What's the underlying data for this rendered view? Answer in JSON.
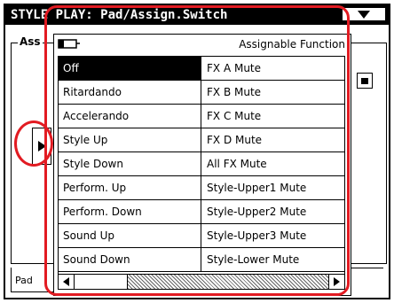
{
  "window": {
    "title": "STYLE PLAY: Pad/Assign.Switch"
  },
  "background": {
    "frame_label": "Ass",
    "tab_label": "Pad"
  },
  "popup": {
    "header_label": "Assignable Function",
    "rows": [
      {
        "left": "Off",
        "right": "FX A Mute",
        "selected": true
      },
      {
        "left": "Ritardando",
        "right": "FX B Mute"
      },
      {
        "left": "Accelerando",
        "right": "FX C Mute"
      },
      {
        "left": "Style Up",
        "right": "FX D Mute"
      },
      {
        "left": "Style Down",
        "right": "All FX Mute"
      },
      {
        "left": "Perform. Up",
        "right": "Style-Upper1 Mute"
      },
      {
        "left": "Perform. Down",
        "right": "Style-Upper2 Mute"
      },
      {
        "left": "Sound Up",
        "right": "Style-Upper3 Mute"
      },
      {
        "left": "Sound Down",
        "right": "Style-Lower Mute"
      }
    ]
  },
  "annotation_color": "#e21b22"
}
